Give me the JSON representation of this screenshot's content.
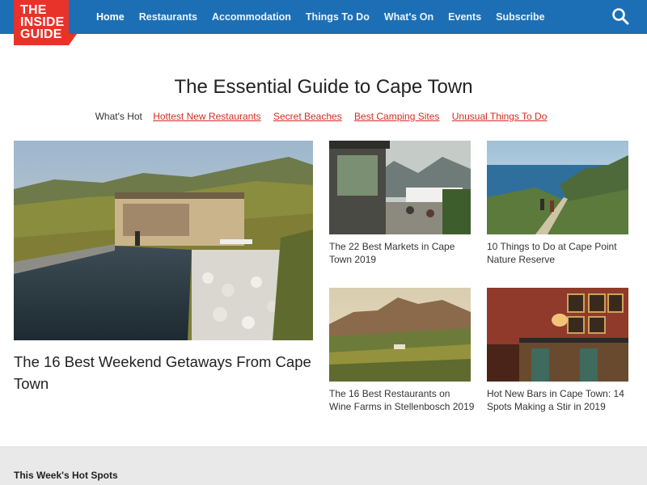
{
  "logo": {
    "line1": "THE",
    "line2": "INSIDE",
    "line3": "GUIDE"
  },
  "nav": [
    {
      "label": "Home",
      "active": true
    },
    {
      "label": "Restaurants"
    },
    {
      "label": "Accommodation"
    },
    {
      "label": "Things To Do"
    },
    {
      "label": "What's On"
    },
    {
      "label": "Events"
    },
    {
      "label": "Subscribe"
    }
  ],
  "search": {
    "icon": "search-icon"
  },
  "page": {
    "title": "The Essential Guide to Cape Town"
  },
  "hot": {
    "label": "What's Hot",
    "links": [
      "Hottest New Restaurants",
      "Secret Beaches",
      "Best Camping Sites",
      "Unusual Things To Do"
    ]
  },
  "feature": {
    "title": "The 16 Best Weekend Getaways From Cape Town"
  },
  "cards": [
    {
      "title": "The 22 Best Markets in Cape Town 2019"
    },
    {
      "title": "10 Things to Do at Cape Point Nature Reserve"
    },
    {
      "title": "The 16 Best Restaurants on Wine Farms in Stellenbosch 2019"
    },
    {
      "title": "Hot New Bars in Cape Town: 14 Spots Making a Stir in 2019"
    }
  ],
  "section": {
    "title": "This Week's Hot Spots"
  },
  "colors": {
    "header": "#1c6fb4",
    "logo": "#e8332a",
    "link": "#d62b22"
  }
}
